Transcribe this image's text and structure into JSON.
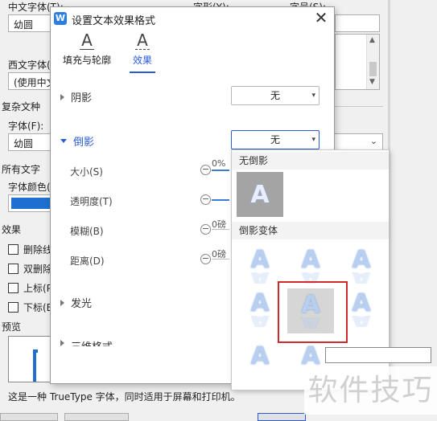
{
  "bg_dialog": {
    "chinese_font_label": "中文字体(T):",
    "font_style_label": "字形(Y):",
    "font_size_label": "字号(S):",
    "chinese_font_value": "幼圆",
    "western_font_label": "西文字体(",
    "western_font_value": "(使用中文",
    "complex_label": "复杂文种",
    "font_label": "字体(F):",
    "font_value": "幼圆",
    "all_text_label": "所有文字",
    "font_color_label": "字体颜色(",
    "effects_label": "效果",
    "effects": [
      "删除线",
      "双删除",
      "上标(P",
      "下标(B"
    ],
    "preview_label": "预览",
    "status_text": "这是一种 TrueType 字体，同时适用于屏幕和打印机。"
  },
  "panel": {
    "title": "设置文本效果格式",
    "close_icon": "✕",
    "tabs": [
      {
        "label": "填充与轮廓",
        "icon": "text-fill-outline-icon"
      },
      {
        "label": "效果",
        "icon": "text-effects-icon"
      }
    ],
    "sections": {
      "shadow": {
        "label": "阴影",
        "value": "无"
      },
      "reflection": {
        "label": "倒影",
        "value": "无"
      },
      "glow": {
        "label": "发光"
      },
      "three_d": {
        "label": "三维格式"
      }
    },
    "reflection_props": [
      {
        "label": "大小(S)",
        "value": "0%"
      },
      {
        "label": "透明度(T)",
        "value": ""
      },
      {
        "label": "模糊(B)",
        "value": "0磅"
      },
      {
        "label": "距离(D)",
        "value": "0磅"
      }
    ]
  },
  "dropdown": {
    "no_reflection_header": "无倒影",
    "variants_header": "倒影变体",
    "glyph": "A"
  },
  "watermark": "软件技巧",
  "colors": {
    "accent": "#2a5bd7",
    "highlight": "#d02a2a",
    "font_color_swatch": "#1f6fd0"
  }
}
